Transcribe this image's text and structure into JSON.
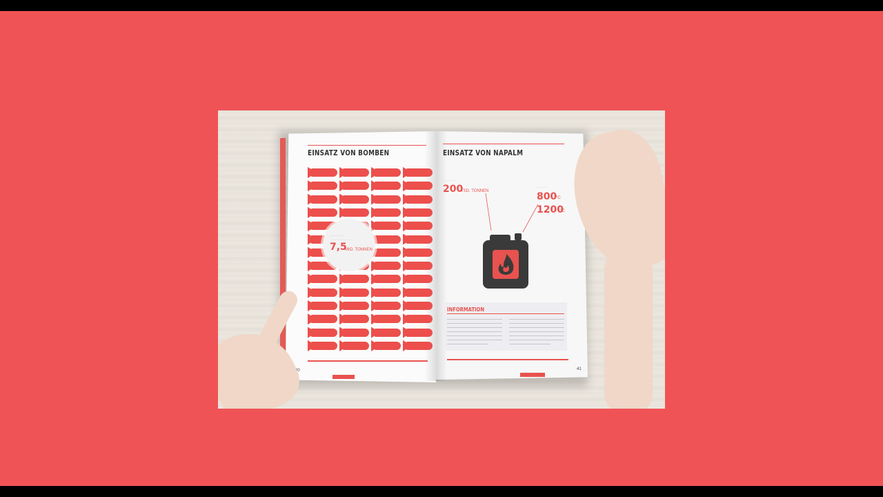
{
  "book": {
    "left_page": {
      "heading": "EINSATZ VON BOMBEN",
      "circle_value": "7,5",
      "circle_unit": "MIO. TONNEN",
      "page_number": "40"
    },
    "right_page": {
      "heading": "EINSATZ VON NAPALM",
      "amount_value": "200",
      "amount_unit": "TSD. TONNEN",
      "temp_low": "800",
      "temp_high": "1200",
      "temp_unit": "°C",
      "info_heading": "INFORMATION",
      "page_number": "41"
    }
  },
  "colors": {
    "background": "#f05356",
    "accent": "#e8524f",
    "canister": "#3a3a3a"
  },
  "icons": [
    "bomb-icon",
    "fuel-canister-icon",
    "fire-icon"
  ]
}
